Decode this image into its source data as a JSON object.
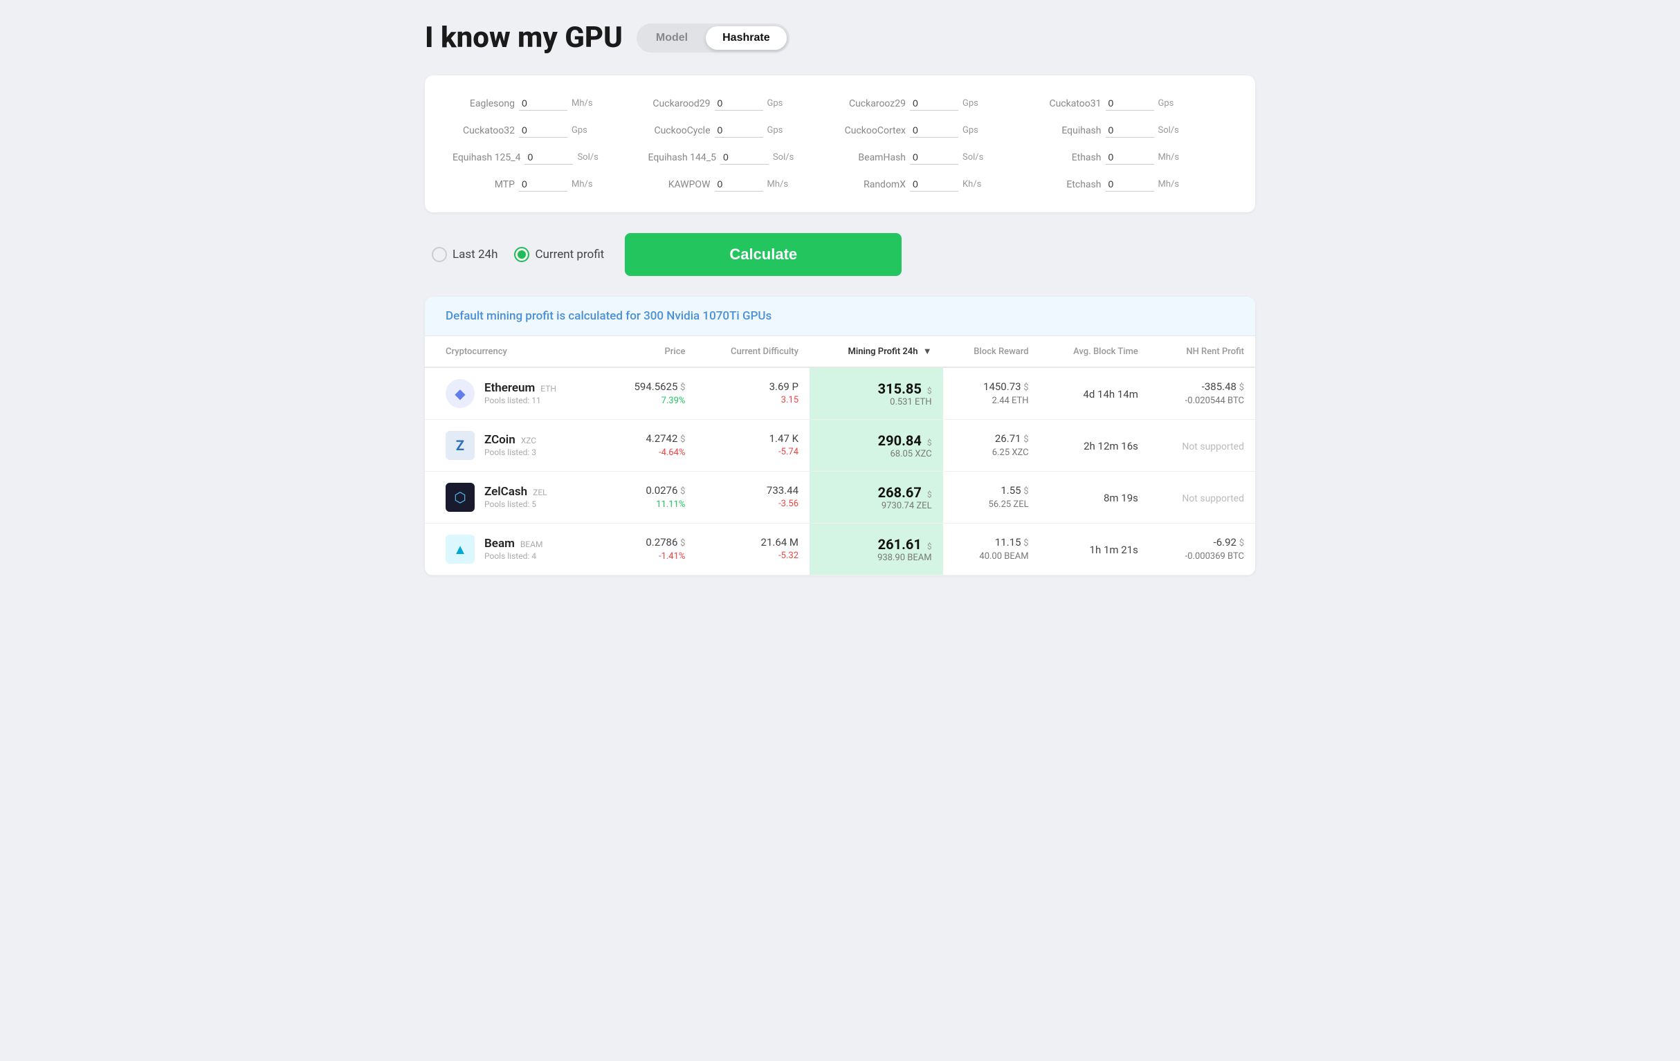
{
  "header": {
    "title": "I know my GPU",
    "mode_model_label": "Model",
    "mode_hashrate_label": "Hashrate",
    "active_mode": "Hashrate"
  },
  "hashrate_panel": {
    "fields": [
      {
        "label": "Eaglesong",
        "value": "0",
        "unit": "Mh/s"
      },
      {
        "label": "Cuckarood29",
        "value": "0",
        "unit": "Gps"
      },
      {
        "label": "Cuckarooz29",
        "value": "0",
        "unit": "Gps"
      },
      {
        "label": "Cuckatoo31",
        "value": "0",
        "unit": "Gps"
      },
      {
        "label": "Cuckatoo32",
        "value": "0",
        "unit": "Gps"
      },
      {
        "label": "CuckooCycle",
        "value": "0",
        "unit": "Gps"
      },
      {
        "label": "CuckooCortex",
        "value": "0",
        "unit": "Gps"
      },
      {
        "label": "Equihash",
        "value": "0",
        "unit": "Sol/s"
      },
      {
        "label": "Equihash 125_4",
        "value": "0",
        "unit": "Sol/s"
      },
      {
        "label": "Equihash 144_5",
        "value": "0",
        "unit": "Sol/s"
      },
      {
        "label": "BeamHash",
        "value": "0",
        "unit": "Sol/s"
      },
      {
        "label": "Ethash",
        "value": "0",
        "unit": "Mh/s"
      },
      {
        "label": "MTP",
        "value": "0",
        "unit": "Mh/s"
      },
      {
        "label": "KAWPOW",
        "value": "0",
        "unit": "Mh/s"
      },
      {
        "label": "RandomX",
        "value": "0",
        "unit": "Kh/s"
      },
      {
        "label": "Etchash",
        "value": "0",
        "unit": "Mh/s"
      }
    ]
  },
  "calc_row": {
    "radio_options": [
      {
        "label": "Last 24h",
        "selected": false
      },
      {
        "label": "Current profit",
        "selected": true
      }
    ],
    "calculate_label": "Calculate"
  },
  "results": {
    "header_text": "Default mining profit is calculated for 300 Nvidia 1070Ti GPUs",
    "table": {
      "columns": [
        {
          "label": "Cryptocurrency",
          "sorted": false
        },
        {
          "label": "Price",
          "sorted": false
        },
        {
          "label": "Current Difficulty",
          "sorted": false
        },
        {
          "label": "Mining Profit 24h",
          "sorted": true
        },
        {
          "label": "Block Reward",
          "sorted": false
        },
        {
          "label": "Avg. Block Time",
          "sorted": false
        },
        {
          "label": "NH Rent Profit",
          "sorted": false
        }
      ],
      "rows": [
        {
          "id": "ethereum",
          "icon": "◆",
          "icon_class": "coin-icon-eth",
          "name": "Ethereum",
          "ticker": "ETH",
          "pools": "Pools listed: 11",
          "price_main": "594.5625",
          "price_usd": "$",
          "price_pct": "7.39%",
          "price_pct_positive": true,
          "diff_main": "3.69 P",
          "diff_change": "3.15",
          "diff_change_positive": false,
          "profit_main": "315.85",
          "profit_usd": "$",
          "profit_sub": "0.531 ETH",
          "reward_main": "1450.73",
          "reward_usd": "$",
          "reward_coin": "2.44 ETH",
          "block_time": "4d 14h 14m",
          "nh_main": "-385.48",
          "nh_usd": "$",
          "nh_btc": "-0.020544 BTC"
        },
        {
          "id": "zcoin",
          "icon": "Z",
          "icon_class": "coin-icon-zcoin",
          "name": "ZCoin",
          "ticker": "XZC",
          "pools": "Pools listed: 3",
          "price_main": "4.2742",
          "price_usd": "$",
          "price_pct": "-4.64%",
          "price_pct_positive": false,
          "diff_main": "1.47 K",
          "diff_change": "-5.74",
          "diff_change_positive": false,
          "profit_main": "290.84",
          "profit_usd": "$",
          "profit_sub": "68.05 XZC",
          "reward_main": "26.71",
          "reward_usd": "$",
          "reward_coin": "6.25 XZC",
          "block_time": "2h 12m 16s",
          "nh_main": null,
          "nh_usd": null,
          "nh_btc": null,
          "nh_not_supported": "Not supported"
        },
        {
          "id": "zelcash",
          "icon": "⬡",
          "icon_class": "coin-icon-zel",
          "name": "ZelCash",
          "ticker": "ZEL",
          "pools": "Pools listed: 5",
          "price_main": "0.0276",
          "price_usd": "$",
          "price_pct": "11.11%",
          "price_pct_positive": true,
          "diff_main": "733.44",
          "diff_change": "-3.56",
          "diff_change_positive": false,
          "profit_main": "268.67",
          "profit_usd": "$",
          "profit_sub": "9730.74 ZEL",
          "reward_main": "1.55",
          "reward_usd": "$",
          "reward_coin": "56.25 ZEL",
          "block_time": "8m 19s",
          "nh_main": null,
          "nh_usd": null,
          "nh_btc": null,
          "nh_not_supported": "Not supported"
        },
        {
          "id": "beam",
          "icon": "▲",
          "icon_class": "coin-icon-beam",
          "name": "Beam",
          "ticker": "BEAM",
          "pools": "Pools listed: 4",
          "price_main": "0.2786",
          "price_usd": "$",
          "price_pct": "-1.41%",
          "price_pct_positive": false,
          "diff_main": "21.64 M",
          "diff_change": "-5.32",
          "diff_change_positive": false,
          "profit_main": "261.61",
          "profit_usd": "$",
          "profit_sub": "938.90 BEAM",
          "reward_main": "11.15",
          "reward_usd": "$",
          "reward_coin": "40.00 BEAM",
          "block_time": "1h 1m 21s",
          "nh_main": "-6.92",
          "nh_usd": "$",
          "nh_btc": "-0.000369 BTC"
        }
      ]
    }
  }
}
